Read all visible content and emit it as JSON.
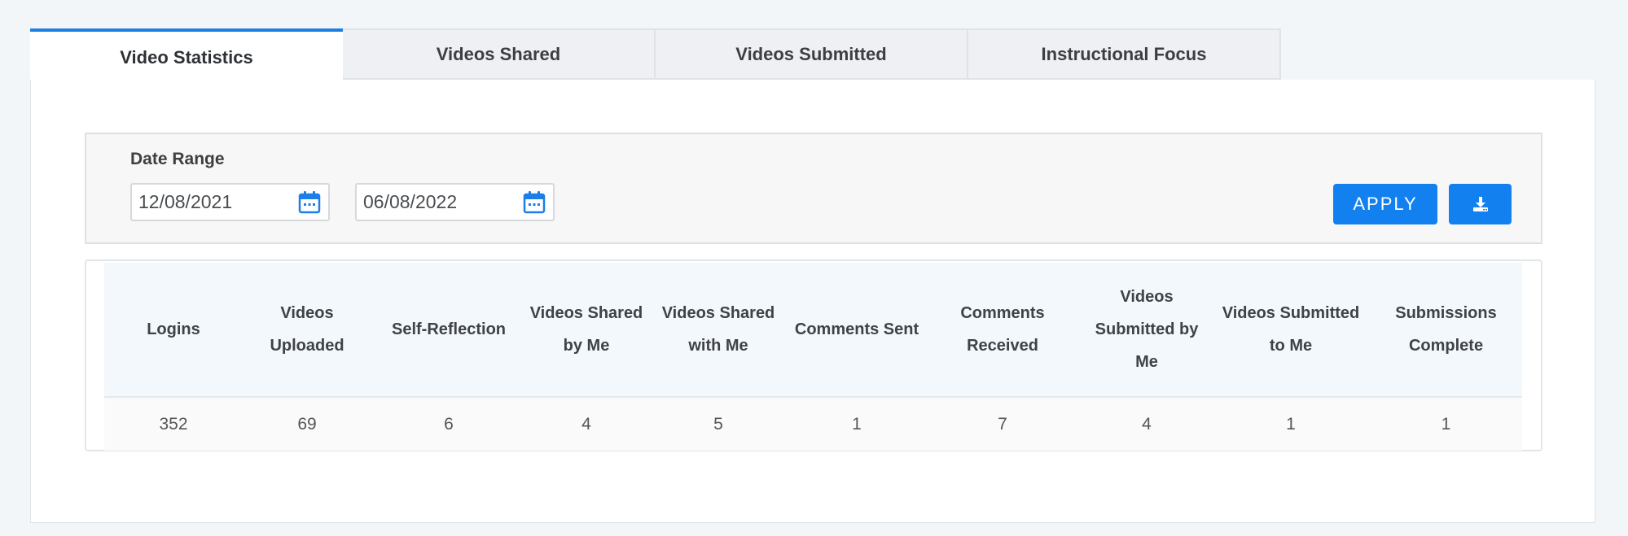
{
  "tabs": [
    {
      "label": "Video Statistics",
      "active": true
    },
    {
      "label": "Videos Shared",
      "active": false
    },
    {
      "label": "Videos Submitted",
      "active": false
    },
    {
      "label": "Instructional Focus",
      "active": false
    }
  ],
  "filter": {
    "label": "Date Range",
    "start_date": "12/08/2021",
    "end_date": "06/08/2022",
    "apply_label": "APPLY",
    "calendar_icon": "calendar-icon",
    "download_icon": "download-icon"
  },
  "stats": {
    "headers": [
      "Logins",
      "Videos Uploaded",
      "Self-Reflection",
      "Videos Shared by Me",
      "Videos Shared with Me",
      "Comments Sent",
      "Comments Received",
      "Videos Submitted by Me",
      "Videos Submitted to Me",
      "Submissions Complete"
    ],
    "values": [
      "352",
      "69",
      "6",
      "4",
      "5",
      "1",
      "7",
      "4",
      "1",
      "1"
    ]
  },
  "colors": {
    "accent": "#1380f0",
    "active_tab_border": "#1f7fe0"
  }
}
